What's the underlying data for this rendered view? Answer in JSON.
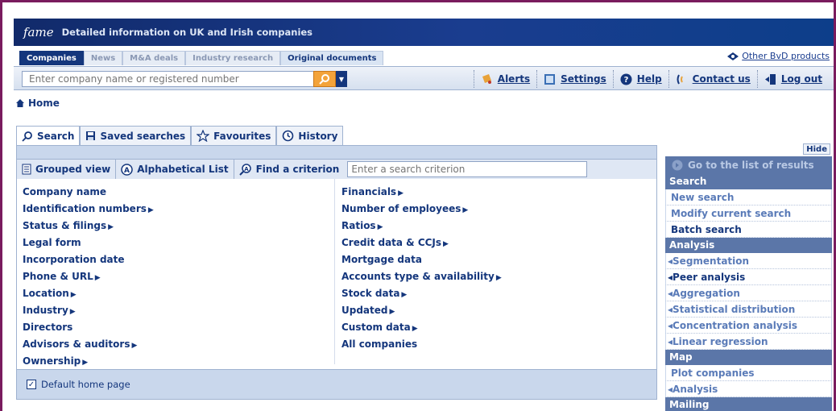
{
  "brand": {
    "logo": "fame",
    "tagline": "Detailed information on UK and Irish companies"
  },
  "tabs": [
    {
      "label": "Companies",
      "state": "active"
    },
    {
      "label": "News",
      "state": "disabled"
    },
    {
      "label": "M&A deals",
      "state": "disabled"
    },
    {
      "label": "Industry research",
      "state": "disabled"
    },
    {
      "label": "Original documents",
      "state": "enabled"
    }
  ],
  "other_products": "Other BvD products",
  "search": {
    "placeholder": "Enter company name or registered number"
  },
  "tools": [
    {
      "label": "Alerts",
      "icon": "alerts-icon"
    },
    {
      "label": "Settings",
      "icon": "settings-icon"
    },
    {
      "label": "Help",
      "icon": "help-icon"
    },
    {
      "label": "Contact us",
      "icon": "contact-icon"
    },
    {
      "label": "Log out",
      "icon": "logout-icon"
    }
  ],
  "breadcrumb": {
    "home": "Home"
  },
  "main_tabs": [
    {
      "label": "Search",
      "icon": "search-icon"
    },
    {
      "label": "Saved searches",
      "icon": "save-icon"
    },
    {
      "label": "Favourites",
      "icon": "star-icon"
    },
    {
      "label": "History",
      "icon": "history-icon"
    }
  ],
  "views": {
    "grouped": "Grouped view",
    "alphabetical": "Alphabetical List",
    "find": "Find a criterion",
    "find_placeholder": "Enter a search criterion"
  },
  "criteria_left": [
    {
      "label": "Company name",
      "arrow": ""
    },
    {
      "label": "Identification numbers",
      "arrow": "▶"
    },
    {
      "label": "Status & filings",
      "arrow": "▶"
    },
    {
      "label": "Legal form",
      "arrow": ""
    },
    {
      "label": "Incorporation date",
      "arrow": ""
    },
    {
      "label": "Phone & URL",
      "arrow": "▶"
    },
    {
      "label": "Location",
      "arrow": "▶"
    },
    {
      "label": "Industry",
      "arrow": "▶"
    },
    {
      "label": "Directors",
      "arrow": ""
    },
    {
      "label": "Advisors & auditors",
      "arrow": "▶"
    },
    {
      "label": "Ownership",
      "arrow": "▶"
    }
  ],
  "criteria_right": [
    {
      "label": "Financials",
      "arrow": "▶"
    },
    {
      "label": "Number of employees",
      "arrow": "▶"
    },
    {
      "label": "Ratios",
      "arrow": "▶"
    },
    {
      "label": "Credit data & CCJs",
      "arrow": "▶"
    },
    {
      "label": "Mortgage data",
      "arrow": ""
    },
    {
      "label": "Accounts type & availability",
      "arrow": "▶"
    },
    {
      "label": "Stock data",
      "arrow": "▶"
    },
    {
      "label": "Updated",
      "arrow": "▶"
    },
    {
      "label": "Custom data",
      "arrow": "▶"
    },
    {
      "label": "All companies",
      "arrow": ""
    }
  ],
  "footer": {
    "default_home": "Default home page",
    "checked": true
  },
  "sidebar": {
    "hide": "Hide",
    "goto": "Go to the list of results",
    "sections": [
      {
        "header": "Search",
        "items": [
          {
            "label": "New search",
            "prefix": "",
            "style": "light"
          },
          {
            "label": "Modify current search",
            "prefix": "",
            "style": "light"
          },
          {
            "label": "Batch search",
            "prefix": "",
            "style": "dark"
          }
        ]
      },
      {
        "header": "Analysis",
        "items": [
          {
            "label": "Segmentation",
            "prefix": "◂",
            "style": "light"
          },
          {
            "label": "Peer analysis",
            "prefix": "◂",
            "style": "dark"
          },
          {
            "label": "Aggregation",
            "prefix": "◂",
            "style": "light"
          },
          {
            "label": "Statistical distribution",
            "prefix": "◂",
            "style": "light"
          },
          {
            "label": "Concentration analysis",
            "prefix": "◂",
            "style": "light"
          },
          {
            "label": "Linear regression",
            "prefix": "◂",
            "style": "light"
          }
        ]
      },
      {
        "header": "Map",
        "items": [
          {
            "label": "Plot companies",
            "prefix": "",
            "style": "light"
          },
          {
            "label": "Analysis",
            "prefix": "◂",
            "style": "light"
          }
        ]
      },
      {
        "header": "Mailing",
        "items": []
      }
    ]
  }
}
